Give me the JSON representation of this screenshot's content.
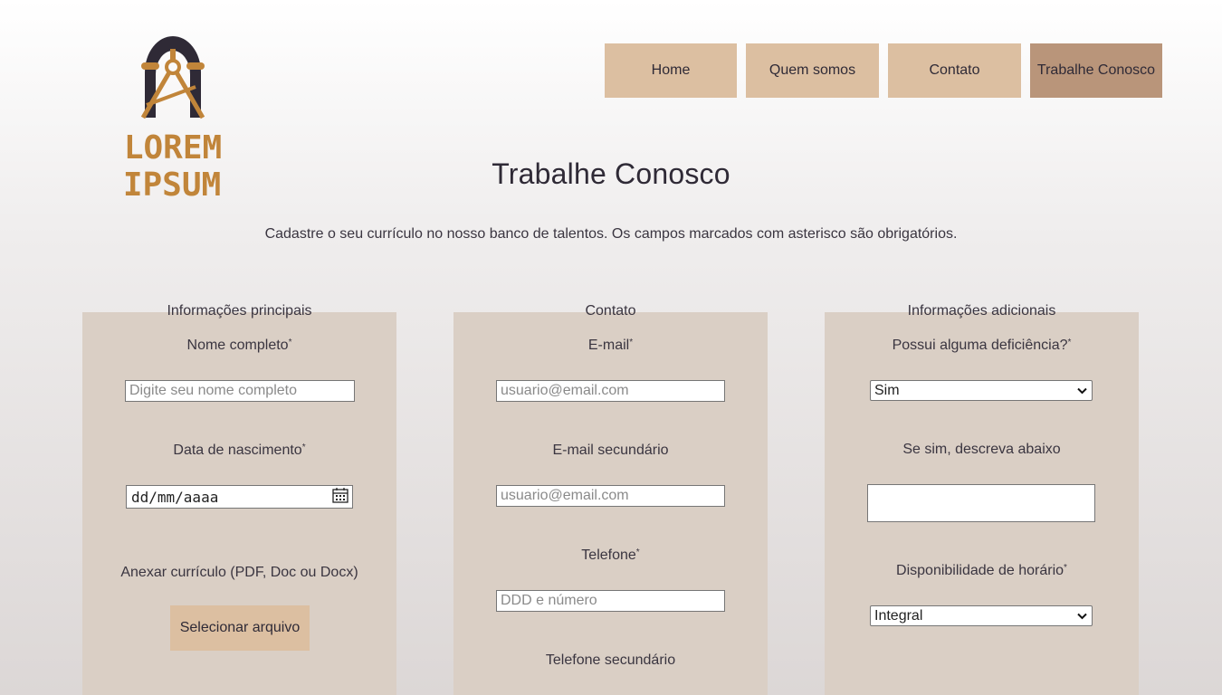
{
  "brand": {
    "logo_line1": "LOREM",
    "logo_line2": "IPSUM"
  },
  "nav": {
    "items": [
      {
        "label": "Home"
      },
      {
        "label": "Quem somos"
      },
      {
        "label": "Contato"
      },
      {
        "label": "Trabalhe Conosco"
      }
    ],
    "active_index": 3
  },
  "page": {
    "title": "Trabalhe Conosco",
    "intro": "Cadastre o seu currículo no nosso banco de talentos. Os campos marcados com asterisco são obrigatórios."
  },
  "required_marker": "*",
  "sections": {
    "main": {
      "title": "Informações principais",
      "name_label": "Nome completo",
      "name_placeholder": "Digite seu nome completo",
      "birth_label": "Data de nascimento",
      "birth_value": "dd/mm/aaaa",
      "resume_label": "Anexar currículo (PDF, Doc ou Docx)",
      "resume_button": "Selecionar arquivo"
    },
    "contact": {
      "title": "Contato",
      "email_label": "E-mail",
      "email_placeholder": "usuario@email.com",
      "email2_label": "E-mail secundário",
      "email2_placeholder": "usuario@email.com",
      "phone_label": "Telefone",
      "phone_placeholder": "DDD e número",
      "phone2_label": "Telefone secundário"
    },
    "extra": {
      "title": "Informações adicionais",
      "disability_label": "Possui alguma deficiência?",
      "disability_value": "Sim",
      "describe_label": "Se sim, descreva abaixo",
      "availability_label": "Disponibilidade de horário",
      "availability_value": "Integral"
    }
  },
  "icons": {
    "calendar": "calendar-icon",
    "dropdown": "chevron-down-icon",
    "logo": "compass-arch-logo"
  },
  "colors": {
    "nav_bg": "#dcbfa1",
    "nav_active_bg": "#b9957a",
    "panel_bg": "#dacfc5",
    "logo_gold": "#c1853a",
    "logo_dark": "#2f2a36"
  }
}
